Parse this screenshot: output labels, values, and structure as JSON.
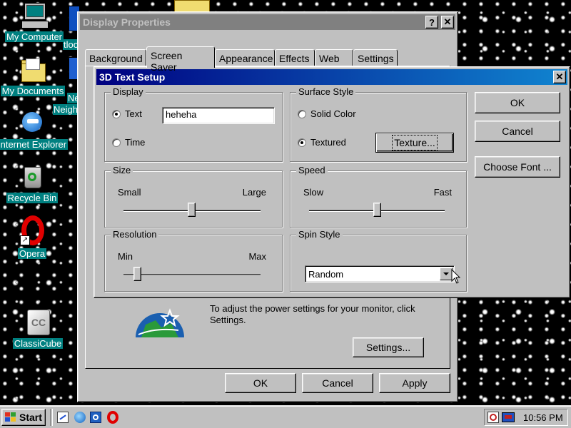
{
  "desktop": {
    "icons": [
      {
        "label": "My Computer"
      },
      {
        "label": "My Documents"
      },
      {
        "label": "Internet Explorer"
      },
      {
        "label": "Recycle Bin"
      },
      {
        "label": "Opera"
      },
      {
        "label": "ClassiCube"
      }
    ],
    "partial_labels": {
      "icon2_a": "tloo",
      "icon2_b": "Ne",
      "icon2_c": "Neigh"
    }
  },
  "display_properties": {
    "title": "Display Properties",
    "tabs": [
      "Background",
      "Screen Saver",
      "Appearance",
      "Effects",
      "Web",
      "Settings"
    ],
    "active_tab": "Screen Saver",
    "power_text": "To adjust the power settings for your monitor, click Settings.",
    "settings_button": "Settings...",
    "ok_button": "OK",
    "cancel_button": "Cancel",
    "apply_button": "Apply",
    "help_glyph": "?",
    "close_glyph": "✕"
  },
  "setup_dialog": {
    "title": "3D Text Setup",
    "close_glyph": "✕",
    "display_group": {
      "label": "Display",
      "text_option": "Text",
      "text_value": "heheha",
      "time_option": "Time",
      "selected": "text"
    },
    "surface_group": {
      "label": "Surface Style",
      "solid_option": "Solid Color",
      "textured_option": "Textured",
      "texture_button": "Texture...",
      "selected": "textured"
    },
    "size_group": {
      "label": "Size",
      "min_label": "Small",
      "max_label": "Large",
      "level": 0.5
    },
    "speed_group": {
      "label": "Speed",
      "min_label": "Slow",
      "max_label": "Fast",
      "level": 0.5
    },
    "resolution_group": {
      "label": "Resolution",
      "min_label": "Min",
      "max_label": "Max",
      "level": 0.1
    },
    "spin_group": {
      "label": "Spin Style",
      "selected": "Random"
    },
    "ok_button": "OK",
    "cancel_button": "Cancel",
    "font_button": "Choose Font ..."
  },
  "taskbar": {
    "start_label": "Start",
    "clock": "10:56 PM"
  },
  "colors": {
    "desktop_teal": "#008080",
    "title_active_start": "#000080",
    "title_active_end": "#1084d0",
    "title_inactive": "#808080",
    "face": "#c0c0c0"
  }
}
